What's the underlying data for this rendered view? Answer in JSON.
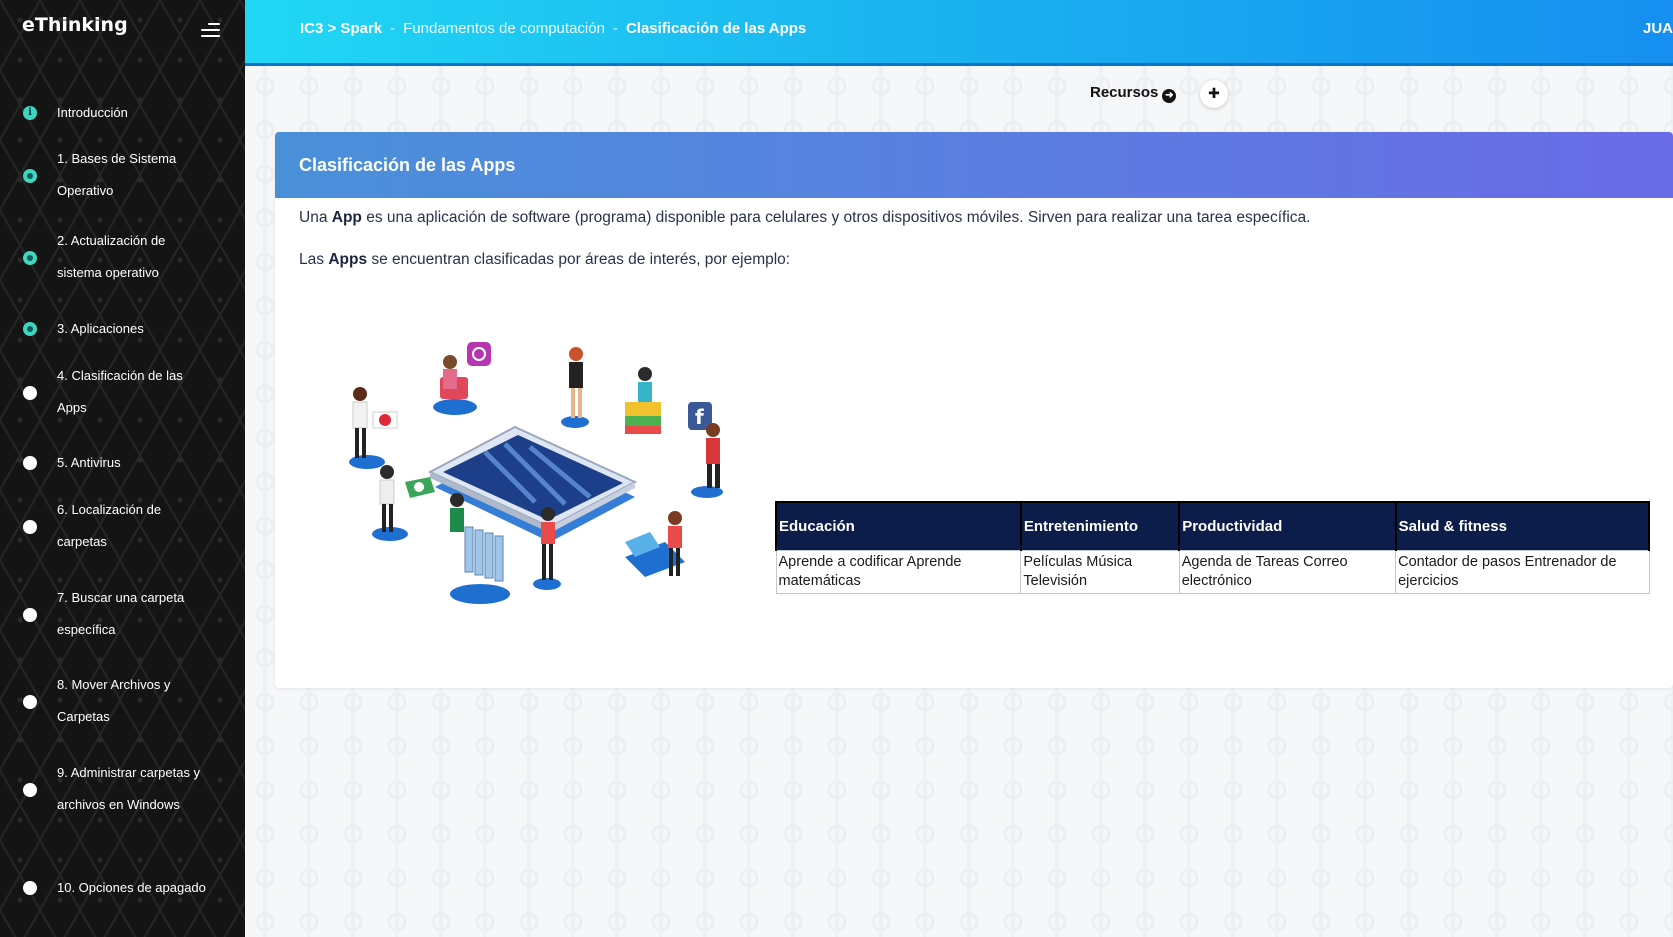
{
  "sidebar": {
    "brand": "eThinking",
    "items": [
      {
        "label": "Introducción",
        "status": "info",
        "icon": "info-icon"
      },
      {
        "label": "1. Bases de Sistema Operativo",
        "status": "done"
      },
      {
        "label": "2. Actualización de sistema operativo",
        "status": "done"
      },
      {
        "label": "3. Aplicaciones",
        "status": "done"
      },
      {
        "label": "4. Clasificación de las Apps",
        "status": "pending"
      },
      {
        "label": "5. Antivirus",
        "status": "pending"
      },
      {
        "label": "6. Localización de carpetas",
        "status": "pending"
      },
      {
        "label": "7. Buscar una carpeta específica",
        "status": "pending"
      },
      {
        "label": "8. Mover Archivos y Carpetas",
        "status": "pending"
      },
      {
        "label": "9. Administrar carpetas y archivos en Windows",
        "status": "pending"
      },
      {
        "label": "10. Opciones de apagado",
        "status": "pending"
      }
    ]
  },
  "topbar": {
    "breadcrumb_root": "IC3 > Spark",
    "breadcrumb_sep": "-",
    "breadcrumb_mid": "Fundamentos de computación",
    "breadcrumb_current": "Clasificación de las Apps",
    "user": "JUA"
  },
  "toolbar": {
    "resources_label": "Recursos",
    "resources_icon": "arrow-circle-right-icon",
    "extension_icon": "puzzle-icon"
  },
  "card": {
    "title": "Clasificación de las Apps",
    "para1_a": "Una ",
    "para1_b": "App",
    "para1_c": " es una aplicación de software (programa) disponible para celulares y otros dispositivos móviles. Sirven para realizar una tarea específica.",
    "para2_a": "Las ",
    "para2_b": "Apps",
    "para2_c": " se encuentran clasificadas por áreas de interés, por ejemplo:"
  },
  "table": {
    "headers": [
      "Educación",
      "Entretenimiento",
      "Productividad",
      "Salud & fitness"
    ],
    "row": [
      "Aprende a codificar Aprende matemáticas",
      "Películas Música Televisión",
      "Agenda de Tareas Correo electrónico",
      "Contador de pasos Entrenador de ejercicios"
    ]
  },
  "colors": {
    "topbar_start": "#21d7f5",
    "topbar_end": "#168ff0",
    "card_header_start": "#4a90d9",
    "card_header_end": "#6a6be6",
    "table_header": "#0d1d4a",
    "done_dot": "#3dd6c0"
  }
}
